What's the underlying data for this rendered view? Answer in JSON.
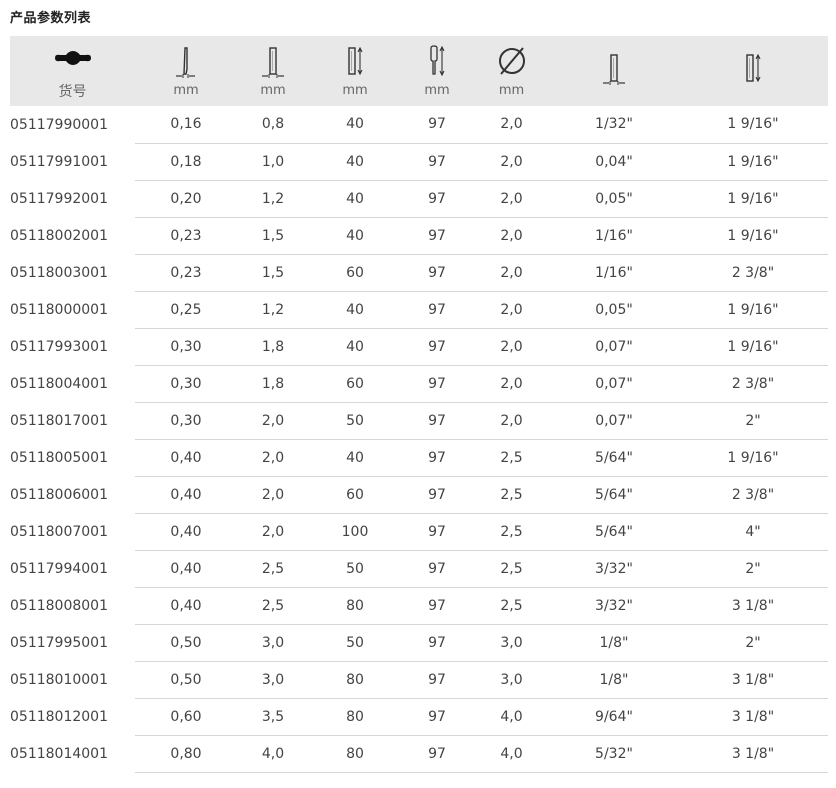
{
  "page": {
    "title": "产品参数列表"
  },
  "table": {
    "headers": [
      {
        "icon": "screwdriver-handle-icon",
        "label": "货号"
      },
      {
        "icon": "tip-thickness-icon",
        "label": "mm"
      },
      {
        "icon": "tip-width-icon",
        "label": "mm"
      },
      {
        "icon": "blade-length-icon",
        "label": "mm"
      },
      {
        "icon": "overall-length-icon",
        "label": "mm"
      },
      {
        "icon": "diameter-icon",
        "label": "mm"
      },
      {
        "icon": "tip-width-inch-icon",
        "label": ""
      },
      {
        "icon": "blade-length-inch-icon",
        "label": ""
      }
    ],
    "rows": [
      [
        "05117990001",
        "0,16",
        "0,8",
        "40",
        "97",
        "2,0",
        "1/32\"",
        "1 9/16\""
      ],
      [
        "05117991001",
        "0,18",
        "1,0",
        "40",
        "97",
        "2,0",
        "0,04\"",
        "1 9/16\""
      ],
      [
        "05117992001",
        "0,20",
        "1,2",
        "40",
        "97",
        "2,0",
        "0,05\"",
        "1 9/16\""
      ],
      [
        "05118002001",
        "0,23",
        "1,5",
        "40",
        "97",
        "2,0",
        "1/16\"",
        "1 9/16\""
      ],
      [
        "05118003001",
        "0,23",
        "1,5",
        "60",
        "97",
        "2,0",
        "1/16\"",
        "2 3/8\""
      ],
      [
        "05118000001",
        "0,25",
        "1,2",
        "40",
        "97",
        "2,0",
        "0,05\"",
        "1 9/16\""
      ],
      [
        "05117993001",
        "0,30",
        "1,8",
        "40",
        "97",
        "2,0",
        "0,07\"",
        "1 9/16\""
      ],
      [
        "05118004001",
        "0,30",
        "1,8",
        "60",
        "97",
        "2,0",
        "0,07\"",
        "2 3/8\""
      ],
      [
        "05118017001",
        "0,30",
        "2,0",
        "50",
        "97",
        "2,0",
        "0,07\"",
        "2\""
      ],
      [
        "05118005001",
        "0,40",
        "2,0",
        "40",
        "97",
        "2,5",
        "5/64\"",
        "1 9/16\""
      ],
      [
        "05118006001",
        "0,40",
        "2,0",
        "60",
        "97",
        "2,5",
        "5/64\"",
        "2 3/8\""
      ],
      [
        "05118007001",
        "0,40",
        "2,0",
        "100",
        "97",
        "2,5",
        "5/64\"",
        "4\""
      ],
      [
        "05117994001",
        "0,40",
        "2,5",
        "50",
        "97",
        "2,5",
        "3/32\"",
        "2\""
      ],
      [
        "05118008001",
        "0,40",
        "2,5",
        "80",
        "97",
        "2,5",
        "3/32\"",
        "3 1/8\""
      ],
      [
        "05117995001",
        "0,50",
        "3,0",
        "50",
        "97",
        "3,0",
        "1/8\"",
        "2\""
      ],
      [
        "05118010001",
        "0,50",
        "3,0",
        "80",
        "97",
        "3,0",
        "1/8\"",
        "3 1/8\""
      ],
      [
        "05118012001",
        "0,60",
        "3,5",
        "80",
        "97",
        "4,0",
        "9/64\"",
        "3 1/8\""
      ],
      [
        "05118014001",
        "0,80",
        "4,0",
        "80",
        "97",
        "4,0",
        "5/32\"",
        "3 1/8\""
      ]
    ]
  }
}
